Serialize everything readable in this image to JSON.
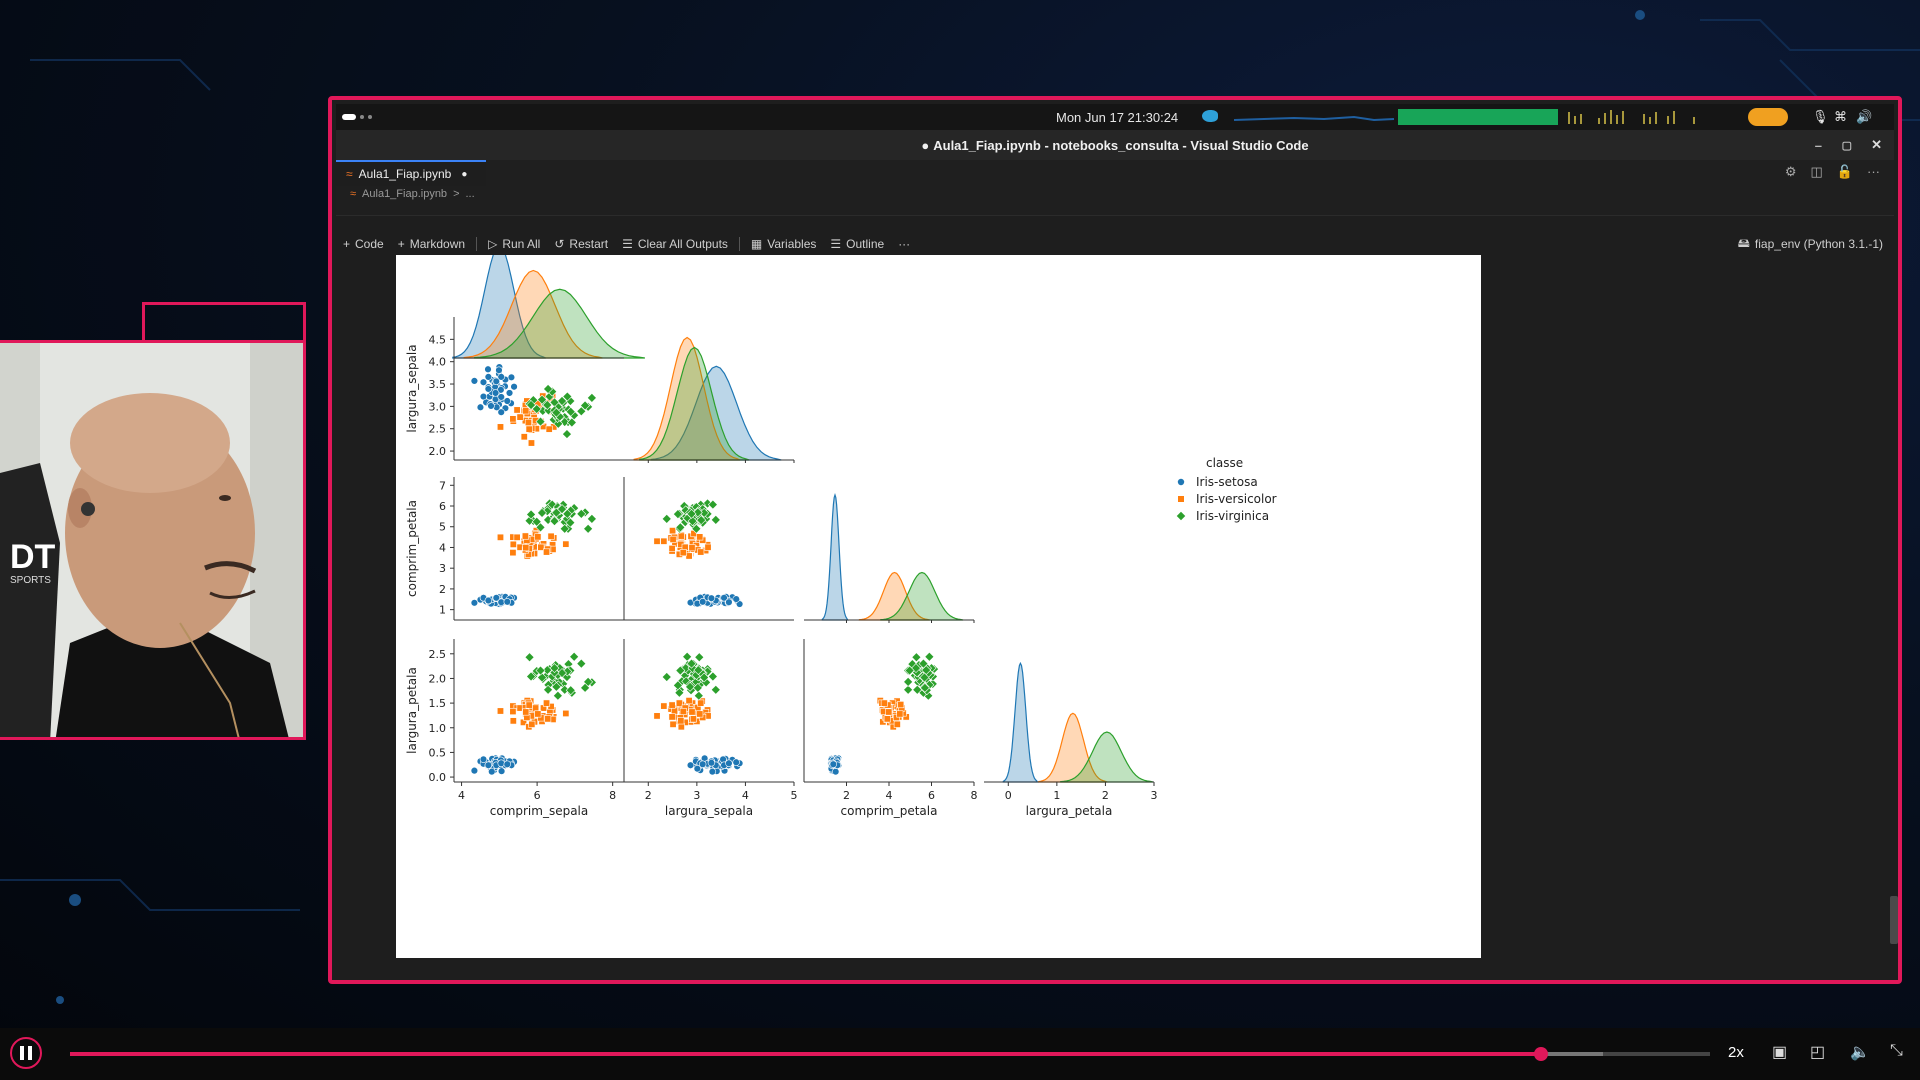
{
  "system_bar": {
    "datetime": "Mon Jun 17  21:30:24"
  },
  "window": {
    "title": "Aula1_Fiap.ipynb - notebooks_consulta - Visual Studio Code",
    "modified_dot": "●"
  },
  "tab": {
    "label": "Aula1_Fiap.ipynb",
    "modified": "●"
  },
  "breadcrumb": {
    "file": "Aula1_Fiap.ipynb",
    "sep": ">",
    "more": "..."
  },
  "toolbar": {
    "code": "Code",
    "markdown": "Markdown",
    "run_all": "Run All",
    "restart": "Restart",
    "clear_outputs": "Clear All Outputs",
    "variables": "Variables",
    "outline": "Outline",
    "more": "···",
    "kernel": "fiap_env (Python 3.1.-1)"
  },
  "player": {
    "speed": "2x",
    "progress": 0.897,
    "buffered": 0.935
  },
  "colors": {
    "frame": "#e0185a",
    "setosa": "#1f77b4",
    "versicolor": "#ff7f0e",
    "virginica": "#2ca02c"
  },
  "chart_data": {
    "type": "scatter",
    "legend_title": "classe",
    "legend_position": "right",
    "series": [
      {
        "name": "Iris-setosa"
      },
      {
        "name": "Iris-versicolor"
      },
      {
        "name": "Iris-virginica"
      }
    ],
    "variables": [
      "comprim_sepala",
      "largura_sepala",
      "comprim_petala",
      "largura_petala"
    ],
    "x_ticks": [
      [
        "4",
        "6",
        "8"
      ],
      [
        "2",
        "3",
        "4",
        "5"
      ],
      [
        "2",
        "4",
        "6",
        "8"
      ],
      [
        "0",
        "1",
        "2",
        "3"
      ]
    ],
    "y_ticks": {
      "largura_sepala": [
        "2.0",
        "2.5",
        "3.0",
        "3.5",
        "4.0",
        "4.5"
      ],
      "comprim_petala": [
        "1",
        "2",
        "3",
        "4",
        "5",
        "6",
        "7"
      ],
      "largura_petala": [
        "0.0",
        "0.5",
        "1.0",
        "1.5",
        "2.0",
        "2.5"
      ]
    },
    "ranges": {
      "comprim_sepala": [
        3.8,
        8.3
      ],
      "largura_sepala": [
        1.8,
        5.0
      ],
      "comprim_petala": [
        0.5,
        7.4
      ],
      "largura_petala": [
        -0.1,
        2.8
      ]
    },
    "x_ranges": {
      "largura_sepala": [
        1.5,
        5.0
      ],
      "comprim_petala": [
        0,
        8
      ],
      "largura_petala": [
        -0.5,
        3.0
      ]
    },
    "kde_peaks": {
      "comprim_sepala": [
        5.0,
        5.9,
        6.6
      ],
      "largura_sepala": [
        3.4,
        2.8,
        2.95
      ],
      "comprim_petala": [
        1.46,
        4.26,
        5.55
      ],
      "largura_petala": [
        0.25,
        1.33,
        2.03
      ]
    }
  }
}
